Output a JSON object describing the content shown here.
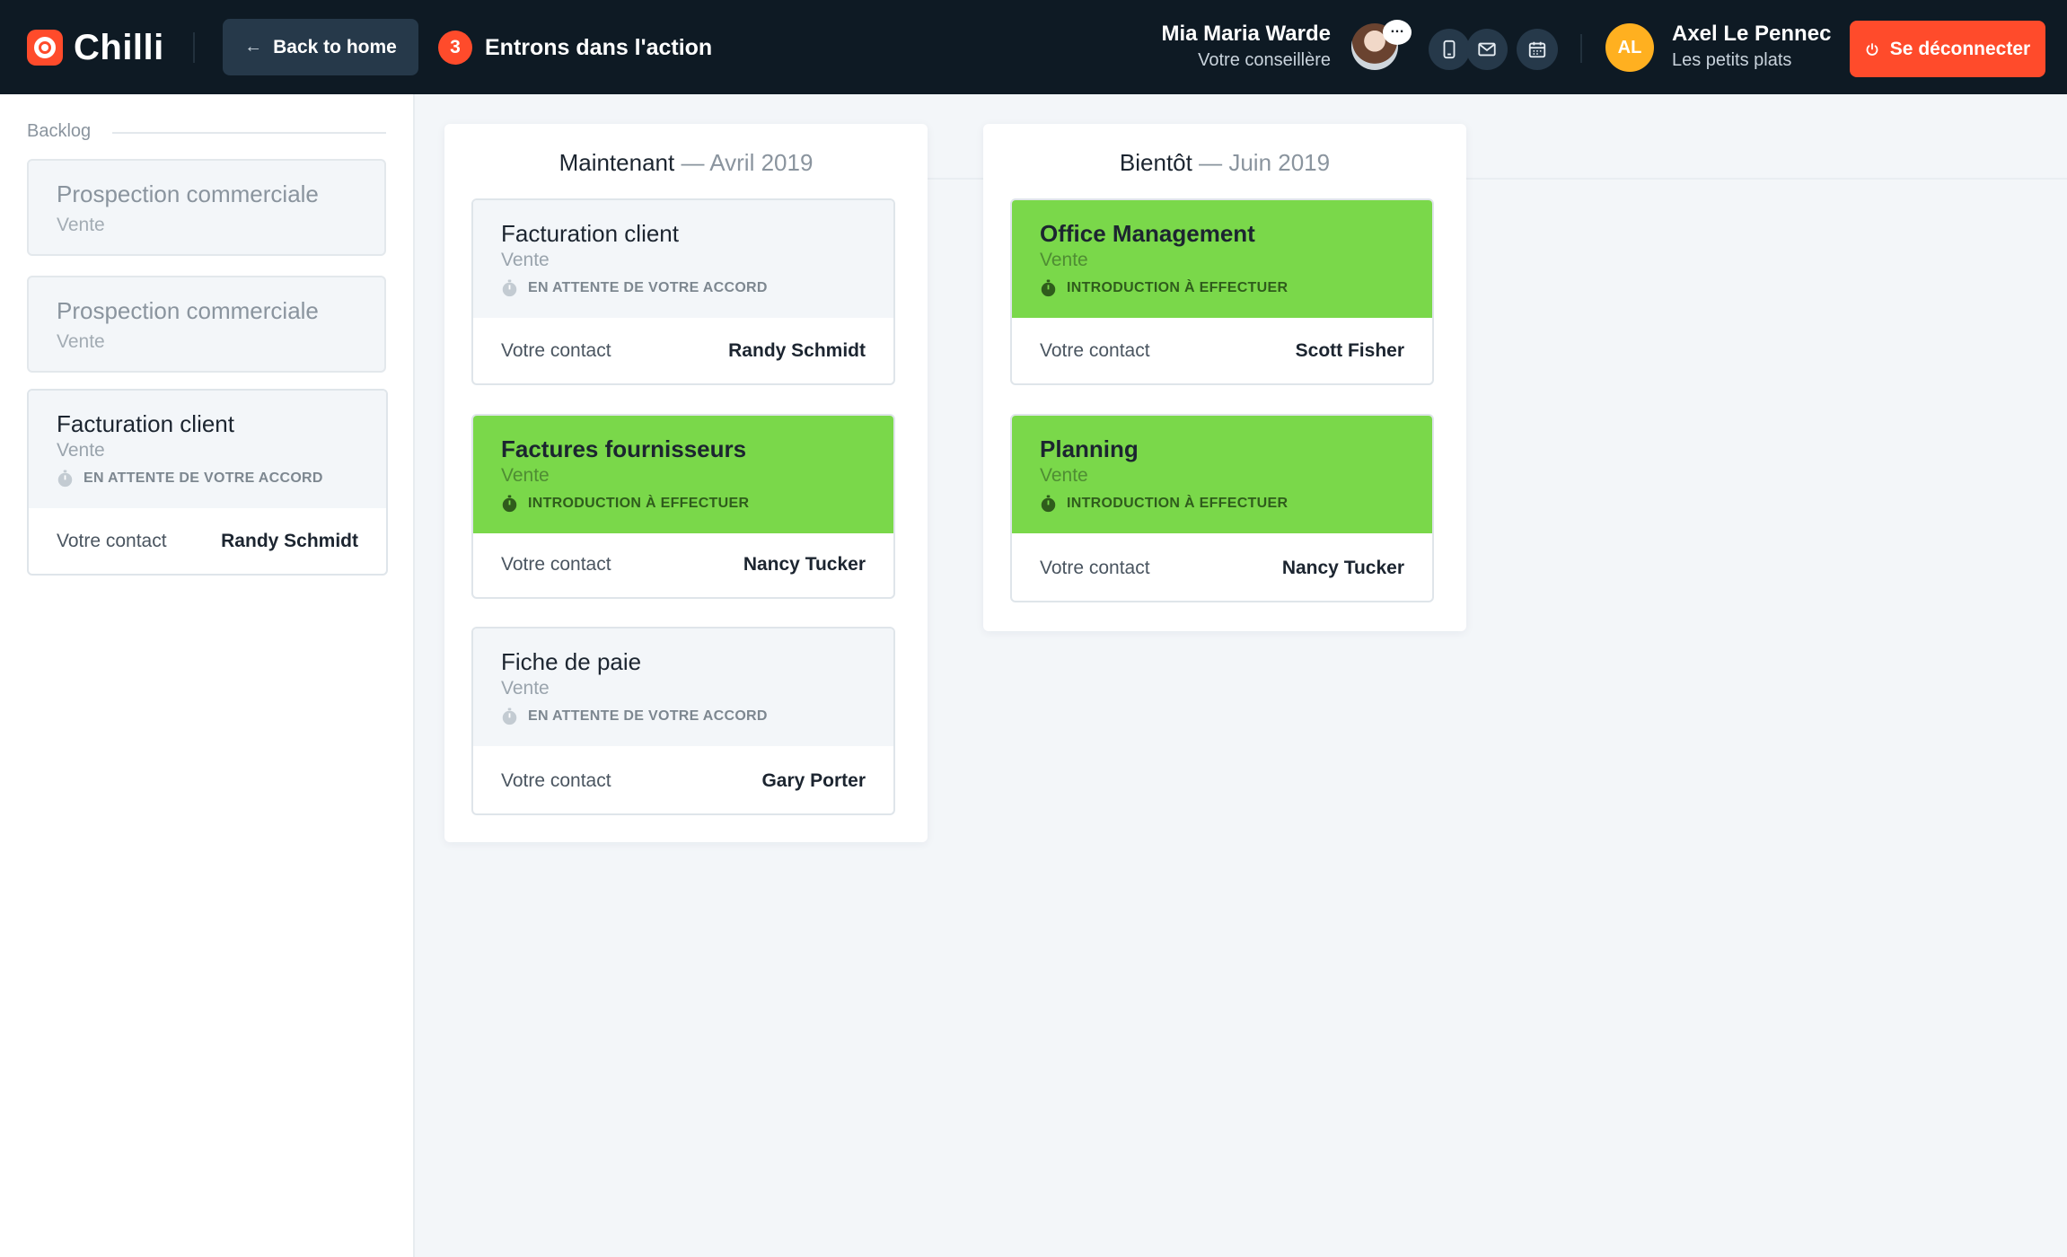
{
  "app": {
    "brand": "Chilli"
  },
  "header": {
    "back_label": "Back to home",
    "step_number": "3",
    "step_label": "Entrons dans l'action",
    "advisor": {
      "name": "Mia Maria Warde",
      "role": "Votre conseillère",
      "chat_glyph": "…"
    },
    "icons": [
      "phone-icon",
      "mail-icon",
      "calendar-icon"
    ],
    "user": {
      "initials": "AL",
      "name": "Axel Le Pennec",
      "company": "Les petits plats"
    },
    "logout_label": "Se déconnecter"
  },
  "sidebar": {
    "title": "Backlog",
    "cards": [
      {
        "title": "Prospection commerciale",
        "subtitle": "Vente"
      },
      {
        "title": "Prospection commerciale",
        "subtitle": "Vente"
      }
    ],
    "task": {
      "title": "Facturation client",
      "subtitle": "Vente",
      "status": "EN ATTENTE DE VOTRE ACCORD",
      "contact_label": "Votre contact",
      "contact_name": "Randy Schmidt"
    }
  },
  "columns": [
    {
      "title": "Maintenant",
      "separator": "—",
      "period": "Avril 2019",
      "cards": [
        {
          "title": "Facturation client",
          "subtitle": "Vente",
          "status": "EN ATTENTE DE VOTRE ACCORD",
          "contact_label": "Votre contact",
          "contact_name": "Randy Schmidt",
          "accent": false
        },
        {
          "title": "Factures fournisseurs",
          "subtitle": "Vente",
          "status": "INTRODUCTION À EFFECTUER",
          "contact_label": "Votre contact",
          "contact_name": "Nancy Tucker",
          "accent": true
        },
        {
          "title": "Fiche de paie",
          "subtitle": "Vente",
          "status": "EN ATTENTE DE VOTRE ACCORD",
          "contact_label": "Votre contact",
          "contact_name": "Gary Porter",
          "accent": false
        }
      ]
    },
    {
      "title": "Bientôt",
      "separator": "—",
      "period": "Juin 2019",
      "cards": [
        {
          "title": "Office Management",
          "subtitle": "Vente",
          "status": "INTRODUCTION À EFFECTUER",
          "contact_label": "Votre contact",
          "contact_name": "Scott Fisher",
          "accent": true
        },
        {
          "title": "Planning",
          "subtitle": "Vente",
          "status": "INTRODUCTION À EFFECTUER",
          "contact_label": "Votre contact",
          "contact_name": "Nancy Tucker",
          "accent": true
        }
      ]
    }
  ],
  "colors": {
    "header_bg": "#0e1a24",
    "accent_red": "#ff4b2b",
    "accent_green": "#7ad84a",
    "avatar_yellow": "#ffb020"
  }
}
